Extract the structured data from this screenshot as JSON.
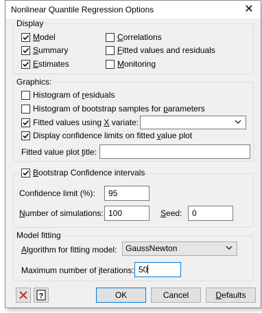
{
  "window": {
    "title": "Nonlinear Quantile Regression Options",
    "close_glyph": "✕"
  },
  "display": {
    "label": "Display",
    "items": [
      {
        "label": "Model",
        "underline": "M",
        "checked": true
      },
      {
        "label": "Summary",
        "underline": "S",
        "checked": true
      },
      {
        "label": "Estimates",
        "underline": "E",
        "checked": true
      },
      {
        "label": "Correlations",
        "underline": "C",
        "checked": false
      },
      {
        "label": "Fitted values and residuals",
        "underline": "F",
        "checked": false
      },
      {
        "label": "Monitoring",
        "underline": "M",
        "checked": false
      }
    ]
  },
  "graphics": {
    "label": "Graphics:",
    "histogram_residuals": {
      "label": "Histogram of residuals",
      "checked": false
    },
    "histogram_bootstrap": {
      "label": "Histogram of bootstrap samples for parameters",
      "checked": false
    },
    "fitted_values_x": {
      "label": "Fitted values using X variate:",
      "checked": true,
      "value": ""
    },
    "display_confidence": {
      "label": "Display confidence limits on fitted value plot",
      "checked": true
    },
    "plot_title": {
      "label": "Fitted value plot title:",
      "value": ""
    }
  },
  "bootstrap": {
    "label": "Bootstrap Confidence intervals",
    "checked": true,
    "confidence_label": "Confidence limit (%):",
    "confidence_value": "95",
    "simulations_label": "Number of simulations:",
    "simulations_value": "100",
    "seed_label": "Seed:",
    "seed_value": "0"
  },
  "model_fitting": {
    "label": "Model fitting",
    "algorithm_label": "Algorithm for fitting model:",
    "algorithm_value": "GaussNewton",
    "max_iter_label": "Maximum number of iterations:",
    "max_iter_value": "50"
  },
  "buttons": {
    "ok": "OK",
    "cancel": "Cancel",
    "defaults": "Defaults"
  },
  "icons": {
    "clear": "clear-x-icon",
    "help": "help-icon"
  },
  "colors": {
    "accent": "#0078d7",
    "clear_red": "#c0392b"
  }
}
